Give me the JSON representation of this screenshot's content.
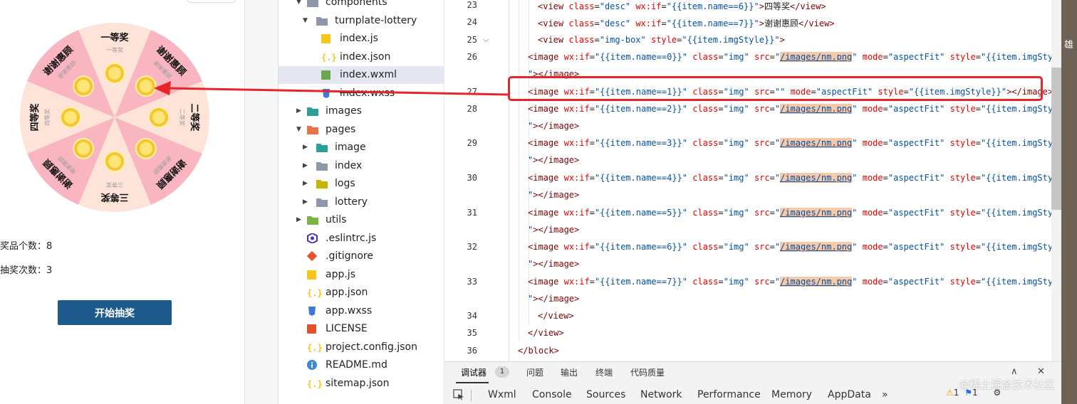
{
  "simulator": {
    "wheel_sections": [
      {
        "title": "一等奖",
        "desc": "一等奖",
        "color": "#fde3d8"
      },
      {
        "title": "谢谢惠顾",
        "desc": "谢谢惠顾",
        "color": "#f9b5c0"
      },
      {
        "title": "二等奖",
        "desc": "二等奖",
        "color": "#fde3d8"
      },
      {
        "title": "谢谢惠顾",
        "desc": "谢谢惠顾",
        "color": "#f9b5c0"
      },
      {
        "title": "三等奖",
        "desc": "三等奖",
        "color": "#fde3d8"
      },
      {
        "title": "谢谢惠顾",
        "desc": "谢谢惠顾",
        "color": "#f9b5c0"
      },
      {
        "title": "四等奖",
        "desc": "四等奖",
        "color": "#fde3d8"
      },
      {
        "title": "谢谢惠顾",
        "desc": "谢谢惠顾",
        "color": "#f9b5c0"
      }
    ],
    "prize_count_label": "奖品个数：8",
    "draw_count_label": "抽奖次数：3",
    "start_button": "开始抽奖",
    "arrow_color": "#e8242a"
  },
  "explorer": {
    "items": [
      {
        "label": "components",
        "icon": "folder-icon",
        "chevron": "expanded",
        "level": 0
      },
      {
        "label": "turnplate-lottery",
        "icon": "folder-icon",
        "chevron": "expanded",
        "level": 1
      },
      {
        "label": "index.js",
        "icon": "js-file-icon",
        "chevron": "none",
        "level": 2
      },
      {
        "label": "index.json",
        "icon": "json-file-icon",
        "chevron": "none",
        "level": 2
      },
      {
        "label": "index.wxml",
        "icon": "wxml-file-icon",
        "chevron": "none",
        "level": 2,
        "selected": true
      },
      {
        "label": "index.wxss",
        "icon": "wxss-file-icon",
        "chevron": "none",
        "level": 2
      },
      {
        "label": "images",
        "icon": "folder-images-icon",
        "chevron": "collapsed",
        "level": 0
      },
      {
        "label": "pages",
        "icon": "folder-pages-icon",
        "chevron": "expanded",
        "level": 0
      },
      {
        "label": "image",
        "icon": "folder-image-icon",
        "chevron": "collapsed",
        "level": 1
      },
      {
        "label": "index",
        "icon": "folder-icon",
        "chevron": "collapsed",
        "level": 1
      },
      {
        "label": "logs",
        "icon": "folder-logs-icon",
        "chevron": "collapsed",
        "level": 1
      },
      {
        "label": "lottery",
        "icon": "folder-icon",
        "chevron": "collapsed",
        "level": 1
      },
      {
        "label": "utils",
        "icon": "folder-utils-icon",
        "chevron": "collapsed",
        "level": 0
      },
      {
        "label": ".eslintrc.js",
        "icon": "eslint-icon",
        "chevron": "none",
        "level": 0
      },
      {
        "label": ".gitignore",
        "icon": "git-icon",
        "chevron": "none",
        "level": 0
      },
      {
        "label": "app.js",
        "icon": "js-file-icon",
        "chevron": "none",
        "level": 0
      },
      {
        "label": "app.json",
        "icon": "json-file-icon",
        "chevron": "none",
        "level": 0
      },
      {
        "label": "app.wxss",
        "icon": "wxss-file-icon",
        "chevron": "none",
        "level": 0
      },
      {
        "label": "LICENSE",
        "icon": "license-icon",
        "chevron": "none",
        "level": 0
      },
      {
        "label": "project.config.json",
        "icon": "json-file-icon",
        "chevron": "none",
        "level": 0
      },
      {
        "label": "README.md",
        "icon": "info-icon",
        "chevron": "none",
        "level": 0
      },
      {
        "label": "sitemap.json",
        "icon": "json-file-icon",
        "chevron": "none",
        "level": 0
      }
    ]
  },
  "editor": {
    "line_numbers": [
      "23",
      "24",
      "25",
      "26",
      "27",
      "28",
      "29",
      "30",
      "31",
      "32",
      "33",
      "34",
      "35",
      "36"
    ],
    "desc6_text": "四等奖",
    "desc7_text": "谢谢惠顾",
    "img_src": "/images/nm.png",
    "img_src_empty": ""
  },
  "panel": {
    "top_tabs": [
      "调试器",
      "问题",
      "输出",
      "终端",
      "代码质量"
    ],
    "debugger_badge": "1",
    "devtools_tabs": [
      "Wxml",
      "Console",
      "Sources",
      "Network",
      "Performance",
      "Memory",
      "AppData",
      "»"
    ],
    "warning_count": "1",
    "error_count": "1",
    "watermark": "@稀土掘金技术社区",
    "top_right_char": "雄"
  }
}
